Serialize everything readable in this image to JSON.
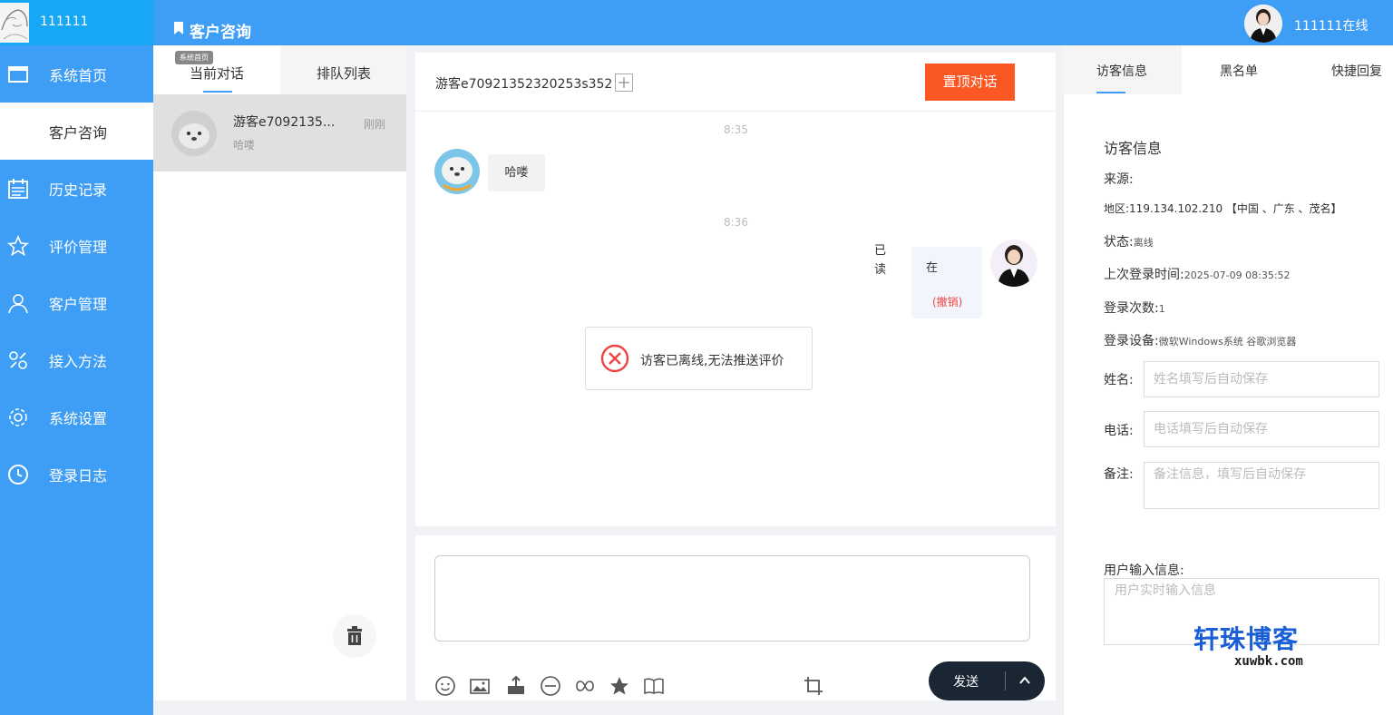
{
  "sidebar": {
    "username": "111111",
    "items": [
      {
        "label": "系统首页",
        "icon": "window-icon",
        "active": false
      },
      {
        "label": "客户咨询",
        "icon": "chat-icon",
        "active": true
      },
      {
        "label": "历史记录",
        "icon": "calendar-list-icon",
        "active": false
      },
      {
        "label": "评价管理",
        "icon": "star-icon",
        "active": false
      },
      {
        "label": "客户管理",
        "icon": "user-icon",
        "active": false
      },
      {
        "label": "接入方法",
        "icon": "link-icon",
        "active": false
      },
      {
        "label": "系统设置",
        "icon": "gear-icon",
        "active": false
      },
      {
        "label": "登录日志",
        "icon": "clock-icon",
        "active": false
      }
    ]
  },
  "header": {
    "title": "客户咨询",
    "status": "111111在线"
  },
  "conversations": {
    "tabs": [
      "当前对话",
      "排队列表"
    ],
    "tooltip": "系统首页",
    "items": [
      {
        "name": "游客e7092135...",
        "time": "刚刚",
        "preview": "哈喽"
      }
    ]
  },
  "chat": {
    "visitor": "游客e70921352320253s352",
    "pin_label": "置顶对话",
    "messages": [
      {
        "time": "8:35",
        "text": "哈喽",
        "side": "left"
      },
      {
        "time": "8:36",
        "text": "在",
        "side": "right",
        "read": "已读",
        "revoke": "(撤销)"
      }
    ],
    "toast": "访客已离线,无法推送评价",
    "send_label": "发送",
    "input_placeholder": ""
  },
  "info": {
    "tabs": [
      "访客信息",
      "黑名单",
      "快捷回复"
    ],
    "title": "访客信息",
    "source_label": "来源:",
    "region_label": "地区:",
    "region_value": "119.134.102.210 【中国 、广东 、茂名】",
    "status_label": "状态:",
    "status_value": "离线",
    "last_login_label": "上次登录时间:",
    "last_login_value": "2025-07-09 08:35:52",
    "login_count_label": "登录次数:",
    "login_count_value": "1",
    "device_label": "登录设备:",
    "device_value": "微软Windows系统 谷歌浏览器",
    "name_label": "姓名:",
    "name_placeholder": "姓名填写后自动保存",
    "phone_label": "电话:",
    "phone_placeholder": "电话填写后自动保存",
    "note_label": "备注:",
    "note_placeholder": "备注信息，填写后自动保存",
    "user_input_label": "用户输入信息:",
    "user_input_placeholder": "用户实时输入信息"
  },
  "watermark": {
    "main": "轩珠博客",
    "sub": "xuwbk.com"
  },
  "colors": {
    "primary": "#3e9df5",
    "pin_button": "#fb5722",
    "send_button": "#1a2633",
    "revoke_text": "#f04444"
  }
}
